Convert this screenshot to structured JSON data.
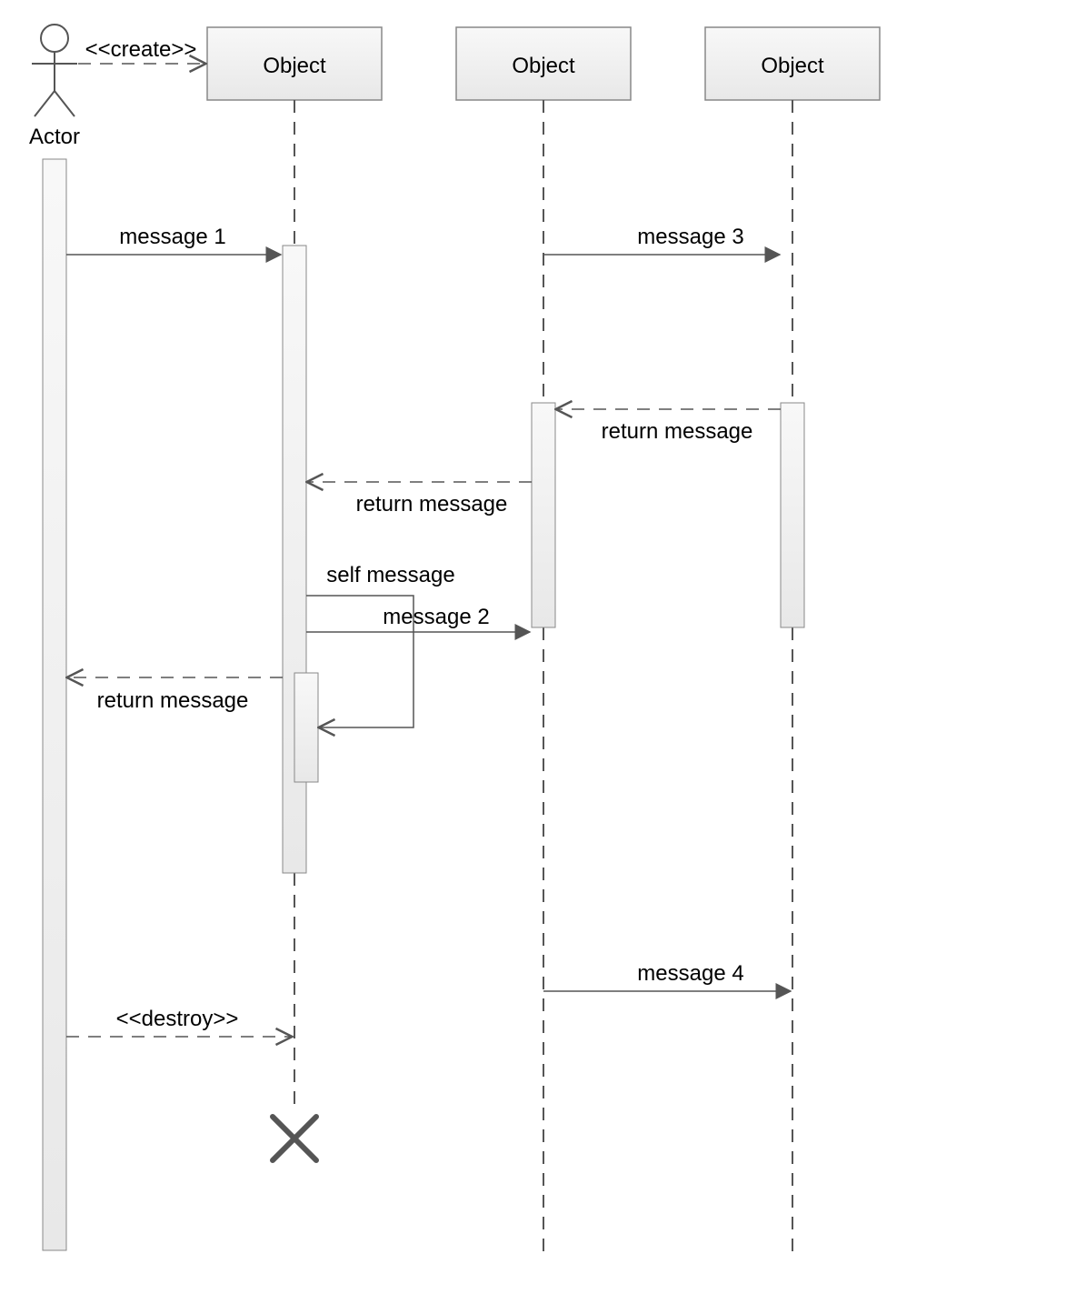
{
  "actor": {
    "label": "Actor"
  },
  "objects": {
    "obj1": "Object",
    "obj2": "Object",
    "obj3": "Object"
  },
  "messages": {
    "create": "<<create>>",
    "destroy": "<<destroy>>",
    "msg1": "message 1",
    "msg2": "message 2",
    "msg3": "message 3",
    "msg4": "message 4",
    "return1": "return message",
    "return2": "return message",
    "return3": "return message",
    "self": "self message"
  }
}
